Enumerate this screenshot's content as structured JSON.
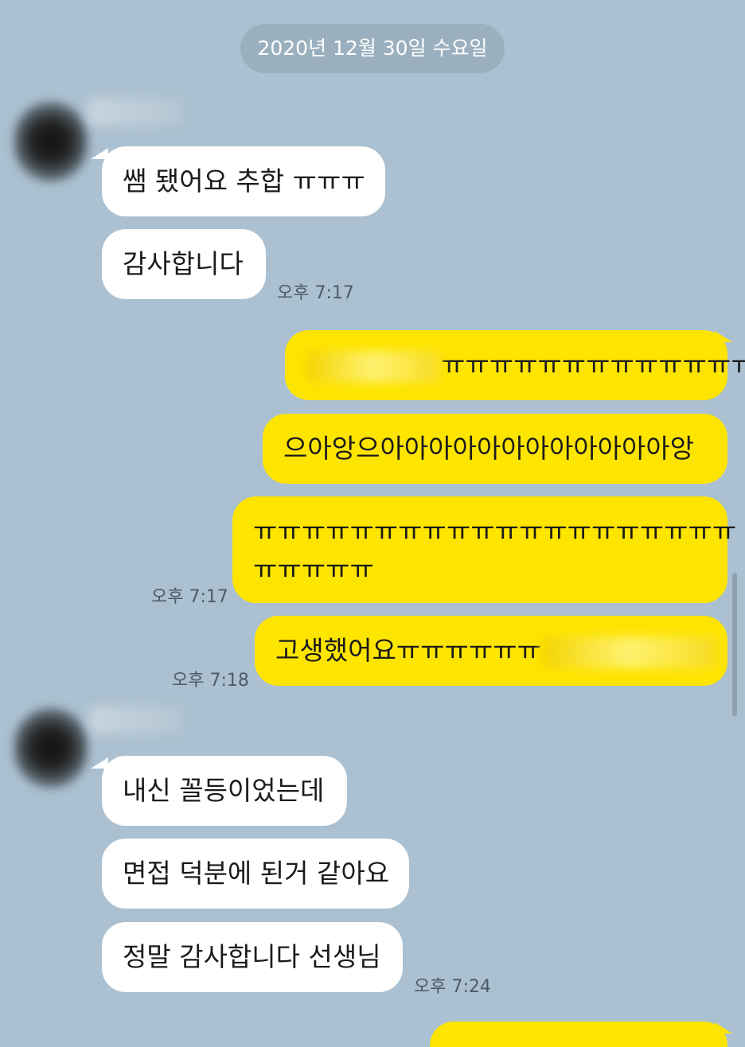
{
  "date_divider": "2020년 12월 30일 수요일",
  "messages": [
    {
      "dir": "in",
      "text": "쌤 됐어요 추합 ㅠㅠㅠ"
    },
    {
      "dir": "in",
      "text": "감사합니다",
      "time": "오후 7:17"
    },
    {
      "dir": "out",
      "text": "ㅠㅠㅠㅠㅠㅠㅠㅠㅠㅠㅠㅠㅠ"
    },
    {
      "dir": "out",
      "text": "으아앙으아아아아아아아아아아아아앙"
    },
    {
      "dir": "out",
      "text_line1": "ㅠㅠㅠㅠㅠㅠㅠㅠㅠㅠㅠㅠㅠㅠㅠㅠㅠㅠㅠㅠ",
      "text_line2": "ㅠㅠㅠㅠㅠ",
      "time": "오후 7:17"
    },
    {
      "dir": "out",
      "text": "고생했어요ㅠㅠㅠㅠㅠㅠ",
      "time": "오후 7:18"
    },
    {
      "dir": "in",
      "text": "내신 꼴등이었는데"
    },
    {
      "dir": "in",
      "text": "면접 덕분에 된거 같아요"
    },
    {
      "dir": "in",
      "text": "정말 감사합니다 선생님",
      "time": "오후 7:24"
    }
  ],
  "colors": {
    "background": "#abc1d1",
    "incoming": "#ffffff",
    "outgoing": "#fee500",
    "date_pill": "#9bb0bf"
  }
}
